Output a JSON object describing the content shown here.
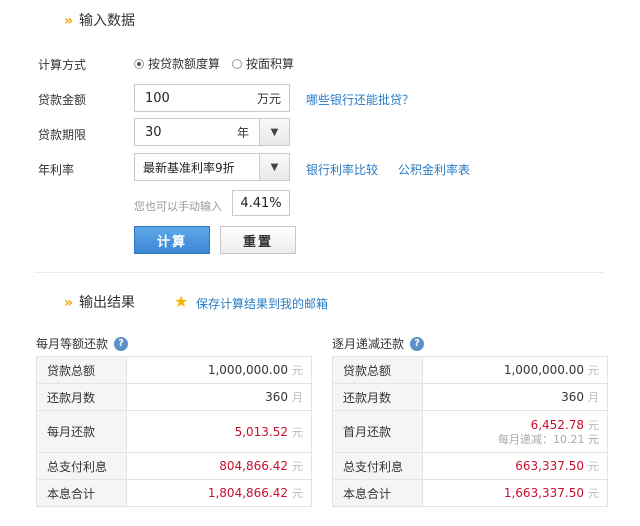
{
  "input_section": {
    "title": "输入数据",
    "method_label": "计算方式",
    "method_options": [
      "按贷款额度算",
      "按面积算"
    ],
    "method_selected": 0,
    "amount_label": "贷款金额",
    "amount_value": "100",
    "amount_unit": "万元",
    "amount_link": "哪些银行还能批贷？",
    "term_label": "贷款期限",
    "term_value": "30",
    "term_unit": "年",
    "rate_label": "年利率",
    "rate_select": "最新基准利率9折",
    "rate_link_1": "银行利率比较",
    "rate_link_2": "公积金利率表",
    "manual_hint": "您也可以手动输入",
    "manual_rate": "4.41%",
    "calc_button": "计算",
    "reset_button": "重置"
  },
  "output_section": {
    "title": "输出结果",
    "save_link": "保存计算结果到我的邮箱"
  },
  "equal_payment": {
    "title": "每月等额还款",
    "rows": [
      {
        "label": "贷款总额",
        "value": "1,000,000.00",
        "unit": "元"
      },
      {
        "label": "还款月数",
        "value": "360",
        "unit": "月"
      },
      {
        "label": "每月还款",
        "value": "5,013.52",
        "unit": "元"
      },
      {
        "label": "总支付利息",
        "value": "804,866.42",
        "unit": "元"
      },
      {
        "label": "本息合计",
        "value": "1,804,866.42",
        "unit": "元"
      }
    ]
  },
  "decreasing_payment": {
    "title": "逐月递减还款",
    "rows": [
      {
        "label": "贷款总额",
        "value": "1,000,000.00",
        "unit": "元"
      },
      {
        "label": "还款月数",
        "value": "360",
        "unit": "月"
      },
      {
        "label": "首月还款",
        "value": "6,452.78",
        "unit": "元",
        "note": "每月递减：10.21 元"
      },
      {
        "label": "总支付利息",
        "value": "663,337.50",
        "unit": "元"
      },
      {
        "label": "本息合计",
        "value": "1,663,337.50",
        "unit": "元"
      }
    ]
  }
}
